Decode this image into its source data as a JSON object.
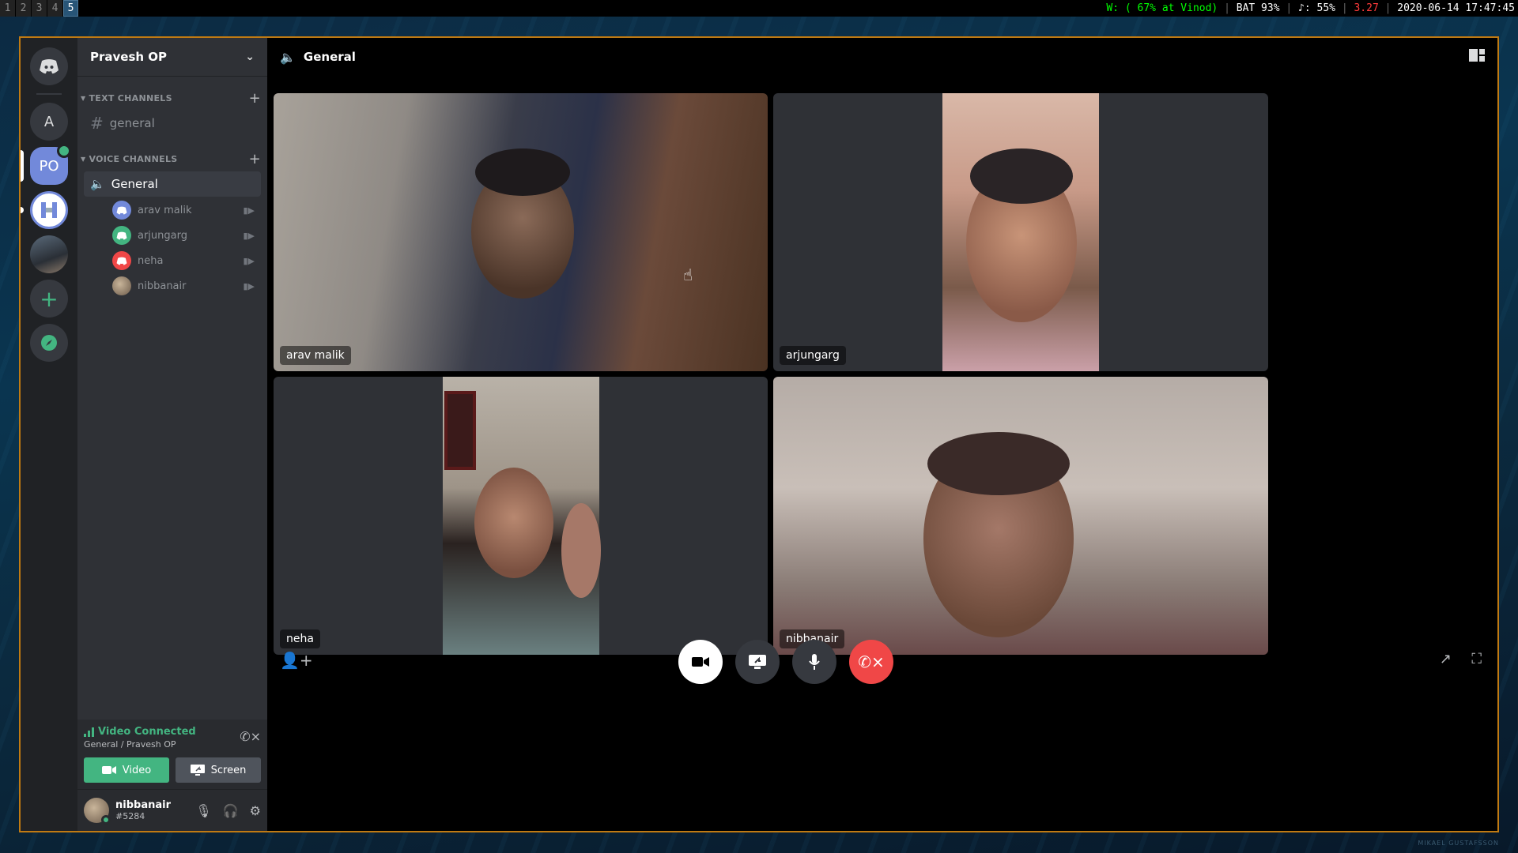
{
  "topbar": {
    "workspaces": [
      "1",
      "2",
      "3",
      "4",
      "5"
    ],
    "wifi": "W: ( 67% at Vinod)",
    "battery": "BAT 93%",
    "volume": "♪: 55%",
    "load": "3.27",
    "datetime": "2020-06-14 17:47:45"
  },
  "guilds": {
    "a_label": "A",
    "po_label": "PO"
  },
  "server": {
    "name": "Pravesh OP"
  },
  "channels": {
    "text_category": "TEXT CHANNELS",
    "text_channel": "general",
    "voice_category": "VOICE CHANNELS",
    "voice_channel": "General",
    "voice_users": [
      {
        "name": "arav malik",
        "color": "#7289da"
      },
      {
        "name": "arjungarg",
        "color": "#43b581"
      },
      {
        "name": "neha",
        "color": "#f04747"
      },
      {
        "name": "nibbanair",
        "color": "photo"
      }
    ]
  },
  "rtc": {
    "status": "Video Connected",
    "location": "General / Pravesh OP",
    "video_label": "Video",
    "screen_label": "Screen"
  },
  "user": {
    "name": "nibbanair",
    "tag": "#5284"
  },
  "main": {
    "channel_title": "General",
    "tiles": [
      "arav malik",
      "arjungarg",
      "neha",
      "nibbanair"
    ]
  },
  "credit": "MIKAEL GUSTAFSSON",
  "colors": {
    "accent": "#7289da",
    "online": "#43b581",
    "danger": "#f04747",
    "window_border": "#c07a12"
  }
}
